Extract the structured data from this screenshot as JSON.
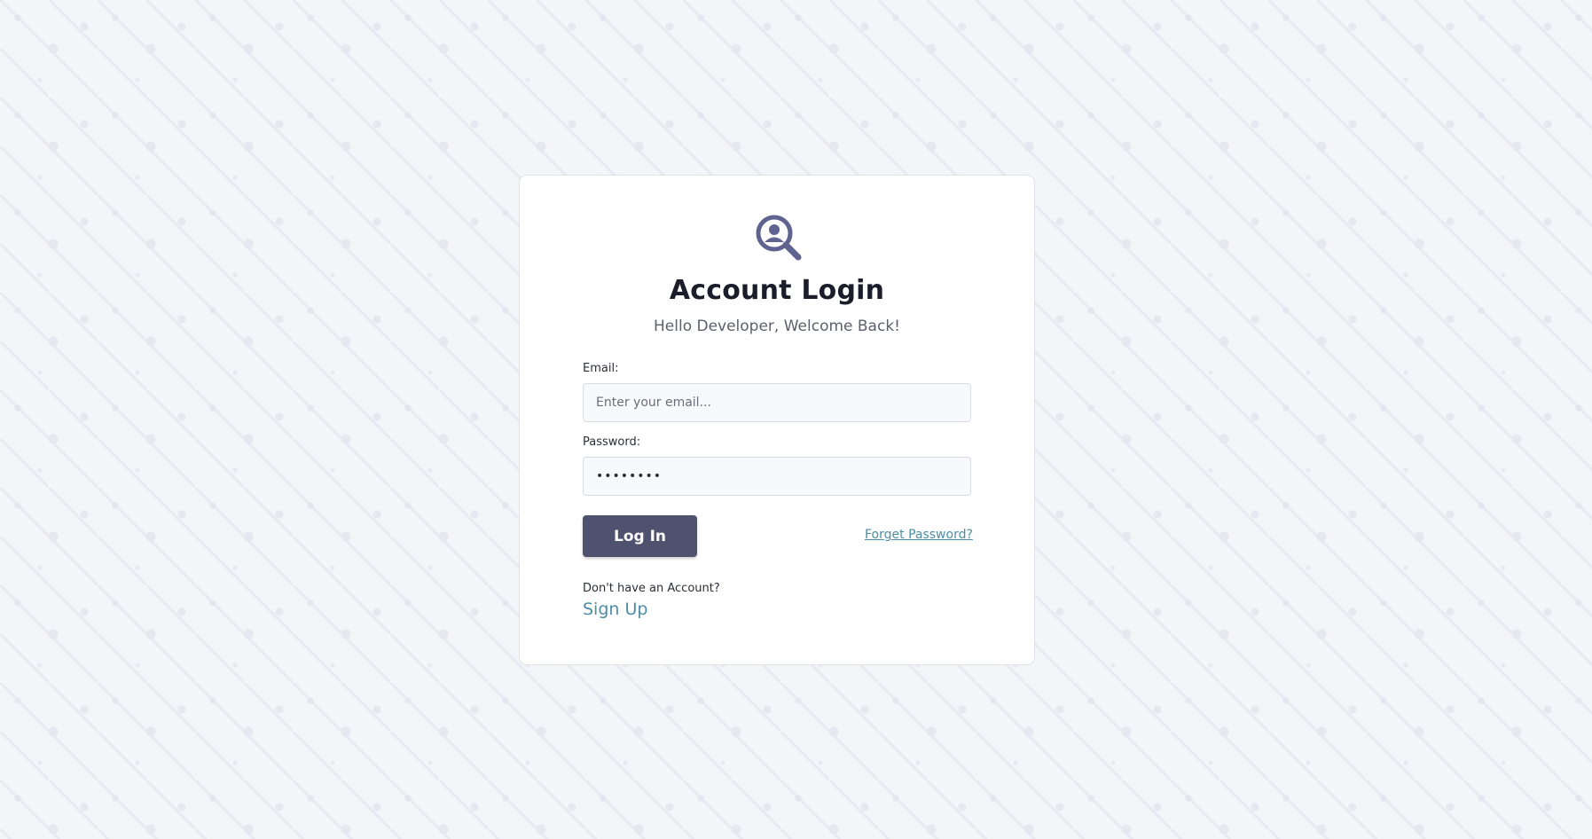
{
  "login_card": {
    "title": "Account Login",
    "subtitle": "Hello Developer, Welcome Back!",
    "logo_icon": "user-search-icon",
    "email": {
      "label": "Email:",
      "placeholder": "Enter your email...",
      "value": ""
    },
    "password": {
      "label": "Password:",
      "value": "••••••••"
    },
    "login_button_label": "Log In",
    "forget_password_label": "Forget Password?",
    "no_account_text": "Don't have an Account?",
    "signup_label": "Sign Up"
  },
  "colors": {
    "accent": "#4f526e",
    "link": "#4d8ea6",
    "icon": "#5f6390",
    "background": "#f4f5f9"
  }
}
